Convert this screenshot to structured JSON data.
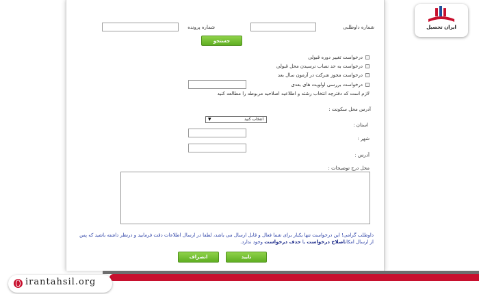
{
  "search": {
    "volunteer_number_label": "شماره داوطلبی",
    "file_number_label": "شماره پرونده",
    "search_button": "جستجو"
  },
  "requests": {
    "items": [
      {
        "label": "درخواست تغییر دوره قبولی"
      },
      {
        "label": "درخواست به حد نصاب نرسیدن محل قبولی"
      },
      {
        "label": "درخواست مجوز شرکت در آزمون سال بعد"
      },
      {
        "label": "درخواست بررسی اولویت های بعدی"
      }
    ],
    "note": "لازم است که دفترچه انتخاب رشته و اطلاعیه اصلاحیه مربوطه را مطالعه کنید"
  },
  "address": {
    "section_label": "آدرس محل سکونت :",
    "province_label": "استان :",
    "province_select": "انتخاب کنید",
    "city_label": "شهر :",
    "address_label": "آدرس :"
  },
  "description": {
    "label": "محل درج توضیحات :"
  },
  "notice": {
    "line1": "داوطلب گرامی! این درخواست تنها یکبار برای شما فعال و قابل ارسال می باشد، لطفا در ارسال اطلاعات دقت فرمایید و درنظر داشته باشید که پس",
    "line2_start": "از ارسال امکان",
    "line2_bold1": "اصلاح درخواست",
    "line2_mid": " یا ",
    "line2_bold2": "حذف درخواست",
    "line2_end": " وجود ندارد."
  },
  "actions": {
    "confirm": "تایید",
    "cancel": "انصراف"
  },
  "branding": {
    "site": "irantahsil.org",
    "logo_text": "ایران تحصیل",
    "accent": "#c8102e"
  }
}
